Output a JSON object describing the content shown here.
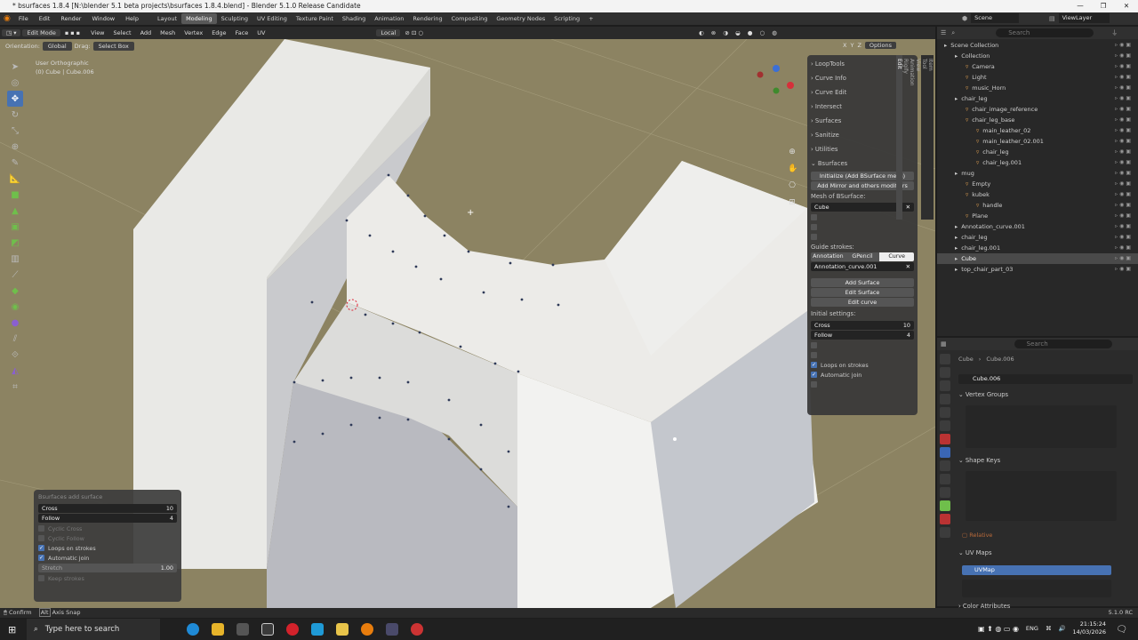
{
  "window": {
    "title": "* bsurfaces 1.8.4 [N:\\blender 5.1 beta projects\\bsurfaces 1.8.4.blend] - Blender 5.1.0 Release Candidate",
    "controls": [
      "—",
      "❐",
      "✕"
    ]
  },
  "menu": [
    "File",
    "Edit",
    "Render",
    "Window",
    "Help"
  ],
  "workspaces": [
    "Layout",
    "Modeling",
    "Sculpting",
    "UV Editing",
    "Texture Paint",
    "Shading",
    "Animation",
    "Rendering",
    "Compositing",
    "Geometry Nodes",
    "Scripting",
    "+"
  ],
  "active_workspace": "Modeling",
  "scene": {
    "scene_label": "Scene",
    "viewlayer_label": "ViewLayer"
  },
  "viewport_header": {
    "mode": "Edit Mode",
    "menus": [
      "View",
      "Select",
      "Add",
      "Mesh",
      "Vertex",
      "Edge",
      "Face",
      "UV"
    ],
    "transform": "Local",
    "options_label": "Options",
    "axes": [
      "X",
      "Y",
      "Z"
    ]
  },
  "tool_settings": {
    "orientation_label": "Orientation:",
    "orientation_value": "Global",
    "drag_label": "Drag:",
    "drag_value": "Select Box"
  },
  "viewport_info": {
    "line1": "User Orthographic",
    "line2": "(0) Cube | Cube.006"
  },
  "npanel": {
    "sections": [
      "LoopTools",
      "Curve Info",
      "Curve Edit",
      "Intersect",
      "Surfaces",
      "Sanitize",
      "Utilities",
      "Bsurfaces"
    ],
    "btn_initialize": "Initialize (Add BSurface mesh)",
    "btn_mirror": "Add Mirror and others modifiers",
    "mesh_label": "Mesh of BSurface:",
    "mesh_value": "Cube",
    "guide_label": "Guide strokes:",
    "guide_tabs": [
      "Annotation",
      "GPencil",
      "Curve"
    ],
    "guide_active": "Curve",
    "curve_value": "Annotation_curve.001",
    "btn_add_surface": "Add Surface",
    "btn_edit_surface": "Edit Surface",
    "btn_edit_curve": "Edit curve",
    "initial_label": "Initial settings:",
    "cross_label": "Cross",
    "cross_value": "10",
    "follow_label": "Follow",
    "follow_value": "4",
    "loops_label": "Loops on strokes",
    "auto_join_label": "Automatic join",
    "tabs": [
      "Item",
      "Tool",
      "View",
      "Animation",
      "Rigify",
      "Edit"
    ]
  },
  "redo_panel": {
    "title": "Bsurfaces add surface",
    "cross_label": "Cross",
    "cross_value": "10",
    "follow_label": "Follow",
    "follow_value": "4",
    "cyclic_cross": "Cyclic Cross",
    "cyclic_follow": "Cyclic Follow",
    "loops_label": "Loops on strokes",
    "auto_join_label": "Automatic join",
    "stretch_label": "Stretch",
    "stretch_value": "1.00",
    "keep_strokes": "Keep strokes"
  },
  "outliner": {
    "search_placeholder": "Search",
    "items": [
      {
        "label": "Scene Collection",
        "depth": 0
      },
      {
        "label": "Collection",
        "depth": 1
      },
      {
        "label": "Camera",
        "depth": 2
      },
      {
        "label": "Light",
        "depth": 2
      },
      {
        "label": "music_Horn",
        "depth": 2
      },
      {
        "label": "chair_leg",
        "depth": 1
      },
      {
        "label": "chair_image_reference",
        "depth": 2
      },
      {
        "label": "chair_leg_base",
        "depth": 2
      },
      {
        "label": "main_leather_02",
        "depth": 3
      },
      {
        "label": "main_leather_02.001",
        "depth": 3
      },
      {
        "label": "chair_leg",
        "depth": 3
      },
      {
        "label": "chair_leg.001",
        "depth": 3
      },
      {
        "label": "mug",
        "depth": 1
      },
      {
        "label": "Empty",
        "depth": 2
      },
      {
        "label": "kubek",
        "depth": 2
      },
      {
        "label": "handle",
        "depth": 3
      },
      {
        "label": "Plane",
        "depth": 2
      },
      {
        "label": "Annotation_curve.001",
        "depth": 1
      },
      {
        "label": "chair_leg",
        "depth": 1
      },
      {
        "label": "chair_leg.001",
        "depth": 1
      },
      {
        "label": "Cube",
        "depth": 1
      },
      {
        "label": "top_chair_part_03",
        "depth": 1
      }
    ],
    "selected": "Cube"
  },
  "properties": {
    "search_placeholder": "Search",
    "breadcrumb_obj": "Cube",
    "breadcrumb_mesh": "Cube.006",
    "mesh_name": "Cube.006",
    "vertex_groups": "Vertex Groups",
    "shape_keys": "Shape Keys",
    "relative": "Relative",
    "uv_maps": "UV Maps",
    "uvmap_item": "UVMap",
    "color_attributes": "Color Attributes"
  },
  "status": {
    "confirm": "Confirm",
    "alt": "Alt",
    "axis_snap": "Axis Snap",
    "version": "5.1.0 RC"
  },
  "taskbar": {
    "search_placeholder": "Type here to search",
    "lang": "ENG",
    "time": "21:15:24",
    "date": "14/03/2026"
  },
  "colors": {
    "accent": "#4772b3",
    "viewport_bg": "#8c8362",
    "panel_bg": "#383838",
    "orange_text": "#b86a3a"
  }
}
